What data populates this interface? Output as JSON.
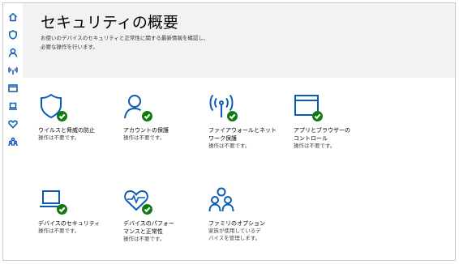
{
  "sidebar": {
    "icons": [
      "home-icon",
      "shield-icon",
      "person-icon",
      "wireless-icon",
      "app-browser-icon",
      "laptop-icon",
      "heart-icon",
      "family-icon"
    ]
  },
  "header": {
    "title": "セキュリティの概要",
    "description_line1": "お使いのデバイスのセキュリティと正常性に関する最新情報を確認し、",
    "description_line2": "必要な操作を行います。"
  },
  "tiles": [
    {
      "icon": "shield-icon",
      "title": "ウイルスと脅威の防止",
      "status": "操作は不要です。",
      "status_color": "#107c10"
    },
    {
      "icon": "person-icon",
      "title": "アカウントの保護",
      "status": "操作は不要です。",
      "status_color": "#107c10"
    },
    {
      "icon": "wireless-icon",
      "title": "ファイアウォールとネット\nワーク保護",
      "status": "操作は不要です。",
      "status_color": "#107c10"
    },
    {
      "icon": "app-browser-icon",
      "title": "アプリとブラウザーの\nコントロール",
      "status": "操作は不要です。",
      "status_color": "#107c10"
    },
    {
      "icon": "laptop-icon",
      "title": "デバイスのセキュリティ",
      "status": "操作は不要です。",
      "status_color": "#107c10"
    },
    {
      "icon": "heart-icon",
      "title": "デバイスのパフォー\nマンスと正常性",
      "status": "操作は不要です。",
      "status_color": "#107c10"
    },
    {
      "icon": "family-icon",
      "title": "ファミリのオプション",
      "status": "家族が使用しているデ\nバイスを管理します。"
    }
  ],
  "colors": {
    "accent": "#0a5bb5",
    "ok": "#107c10",
    "header_bg": "#f2f2f2"
  }
}
